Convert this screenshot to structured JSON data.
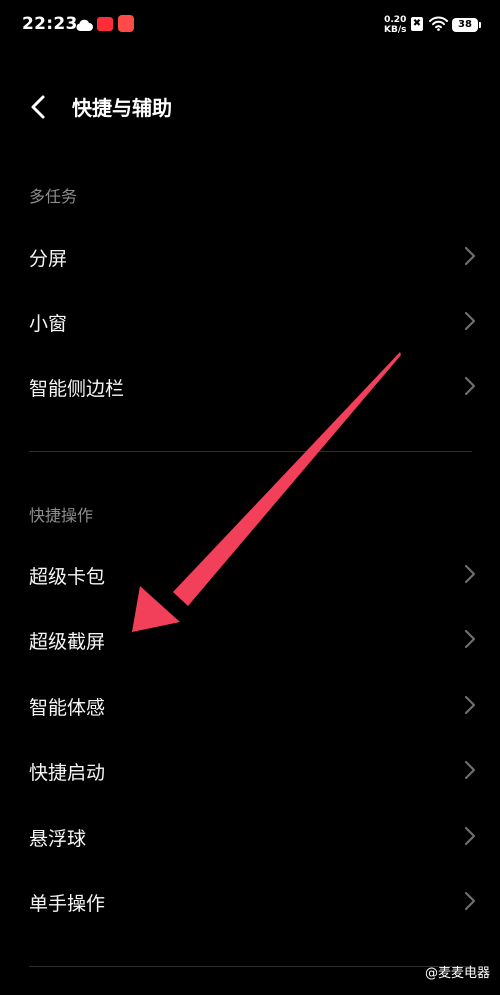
{
  "status_bar": {
    "time": "22:23",
    "net_speed_value": "0.20",
    "net_speed_unit": "KB/s",
    "sim_label": "✖",
    "battery": "38",
    "icons": [
      "cloud-icon",
      "app-notification-icon",
      "app-notification-icon",
      "no-sim-icon",
      "wifi-icon",
      "battery-icon"
    ]
  },
  "header": {
    "title": "快捷与辅助",
    "back_icon": "chevron-left-icon"
  },
  "sections": [
    {
      "header": "多任务",
      "items": [
        {
          "label": "分屏"
        },
        {
          "label": "小窗"
        },
        {
          "label": "智能侧边栏"
        }
      ]
    },
    {
      "header": "快捷操作",
      "items": [
        {
          "label": "超级卡包"
        },
        {
          "label": "超级截屏"
        },
        {
          "label": "智能体感"
        },
        {
          "label": "快捷启动"
        },
        {
          "label": "悬浮球"
        },
        {
          "label": "单手操作"
        }
      ]
    }
  ],
  "row_chevron_icon": "chevron-right-icon",
  "annotation": {
    "color": "#f2405a",
    "points_to": "超级截屏"
  },
  "watermark": "@麦麦电器",
  "colors": {
    "background": "#000000",
    "text": "#f5f5f5",
    "section_header": "#8c8c8c",
    "divider": "#2e2e2e",
    "chevron": "#6e6e6e"
  }
}
